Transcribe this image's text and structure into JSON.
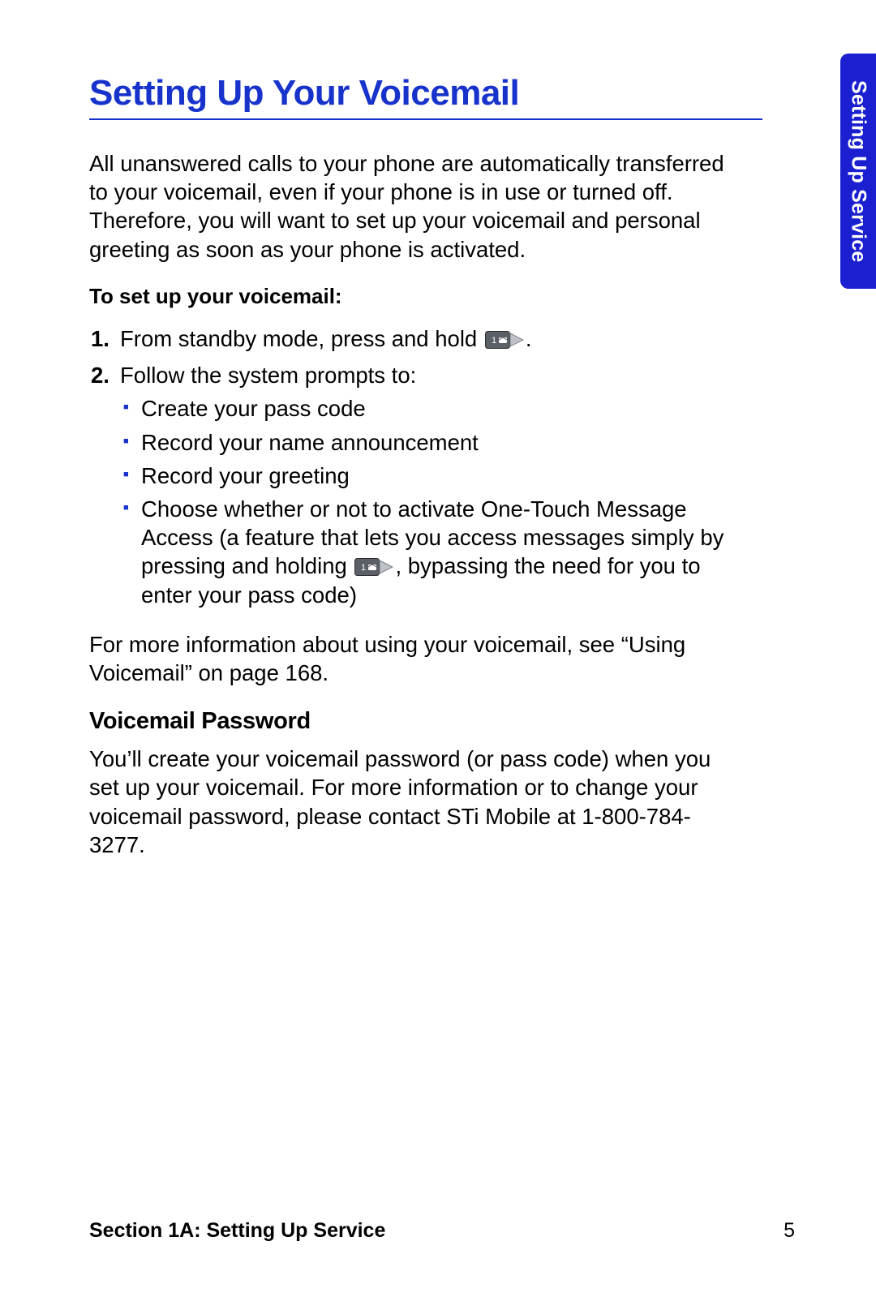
{
  "tab": {
    "label": "Setting Up Service"
  },
  "heading": "Setting Up Your Voicemail",
  "intro": "All unanswered calls to your phone are automatically transferred to your voicemail, even if your phone is in use or turned off. Therefore, you will want to set up your voicemail and personal greeting as soon as your phone is activated.",
  "lead": "To set up your voicemail:",
  "steps": {
    "s1": {
      "num": "1.",
      "pre": "From standby mode, press and hold ",
      "post": "."
    },
    "s2": {
      "num": "2.",
      "text": "Follow the system prompts to:"
    }
  },
  "bullets": {
    "b1": "Create your pass code",
    "b2": "Record your name announcement",
    "b3": "Record your greeting",
    "b4_pre": "Choose whether or not to activate One-Touch Message Access (a feature that lets you access messages simply by pressing and holding ",
    "b4_post": ", bypassing the need for you to enter your pass code)"
  },
  "more_info": "For more information about using your voicemail, see “Using Voicemail” on page 168.",
  "subhead": "Voicemail Password",
  "password_para": "You’ll create your voicemail password (or pass code) when you set up your voicemail. For more information or to change your voicemail password, please contact STi Mobile at 1-800-784-3277.",
  "footer": {
    "section": "Section 1A: Setting Up Service",
    "page": "5"
  }
}
